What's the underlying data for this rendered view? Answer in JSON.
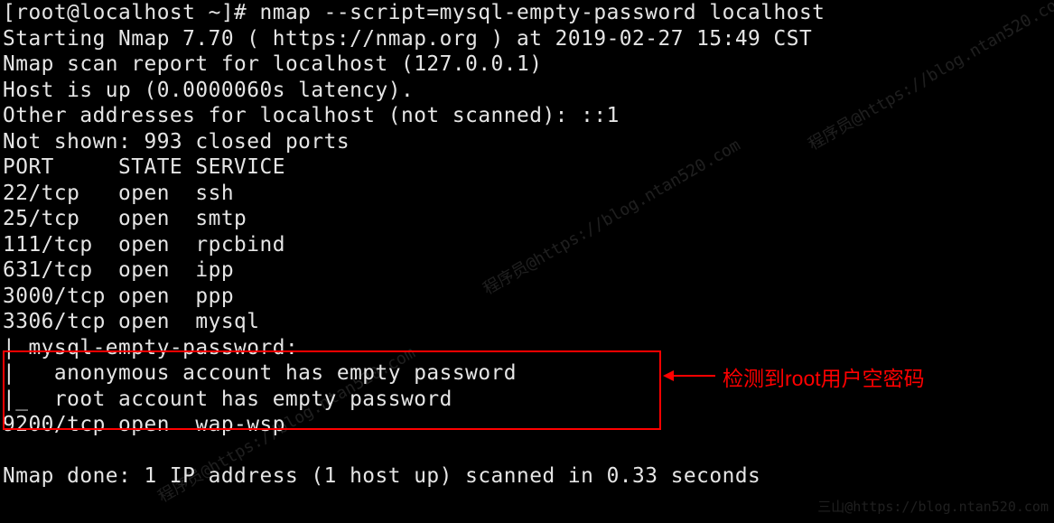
{
  "terminal": {
    "prompt": "[root@localhost ~]# ",
    "command": "nmap --script=mysql-empty-password localhost",
    "lines": [
      "Starting Nmap 7.70 ( https://nmap.org ) at 2019-02-27 15:49 CST",
      "Nmap scan report for localhost (127.0.0.1)",
      "Host is up (0.0000060s latency).",
      "Other addresses for localhost (not scanned): ::1",
      "Not shown: 993 closed ports",
      "PORT     STATE SERVICE",
      "22/tcp   open  ssh",
      "25/tcp   open  smtp",
      "111/tcp  open  rpcbind",
      "631/tcp  open  ipp",
      "3000/tcp open  ppp",
      "3306/tcp open  mysql",
      "| mysql-empty-password: ",
      "|   anonymous account has empty password",
      "|_  root account has empty password",
      "9200/tcp open  wap-wsp",
      "",
      "Nmap done: 1 IP address (1 host up) scanned in 0.33 seconds"
    ]
  },
  "annotation": {
    "text": "检测到root用户空密码"
  },
  "watermark": {
    "diagonal": "程序员@https://blog.ntan520.com",
    "footer": "三山@https://blog.ntan520.com"
  }
}
